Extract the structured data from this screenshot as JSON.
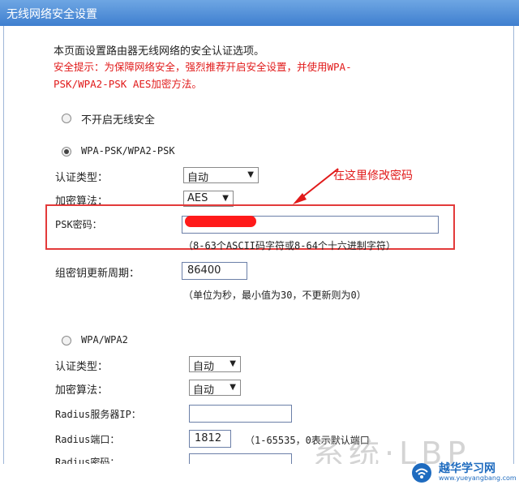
{
  "header": {
    "title": "无线网络安全设置"
  },
  "intro": {
    "line1": "本页面设置路由器无线网络的安全认证选项。",
    "hint_line1": "安全提示：为保障网络安全，强烈推荐开启安全设置，并使用WPA-",
    "hint_line2": "PSK/WPA2-PSK AES加密方法。"
  },
  "options": {
    "no_security": {
      "label": "不开启无线安全",
      "selected": false
    },
    "wpa_psk": {
      "label": "WPA-PSK/WPA2-PSK",
      "selected": true,
      "auth_type_label": "认证类型：",
      "auth_type_value": "自动",
      "encryption_label": "加密算法：",
      "encryption_value": "AES",
      "psk_label": "PSK密码：",
      "psk_hint": "（8-63个ASCII码字符或8-64个十六进制字符）",
      "group_key_label": "组密钥更新周期：",
      "group_key_value": "86400",
      "group_key_hint": "（单位为秒，最小值为30，不更新则为0）"
    },
    "wpa": {
      "label": "WPA/WPA2",
      "selected": false,
      "auth_type_label": "认证类型：",
      "auth_type_value": "自动",
      "encryption_label": "加密算法：",
      "encryption_value": "自动",
      "radius_ip_label": "Radius服务器IP：",
      "radius_port_label": "Radius端口：",
      "radius_port_value": "1812",
      "radius_port_hint": "（1-65535，0表示默认端口",
      "radius_pwd_label": "Radius密码："
    }
  },
  "annotation": {
    "text": "在这里修改密码",
    "color": "#e11a1a"
  },
  "watermark": {
    "text": "系统·LBP"
  },
  "branding": {
    "name": "越华学习网",
    "url": "www.yueyangbang.com"
  }
}
